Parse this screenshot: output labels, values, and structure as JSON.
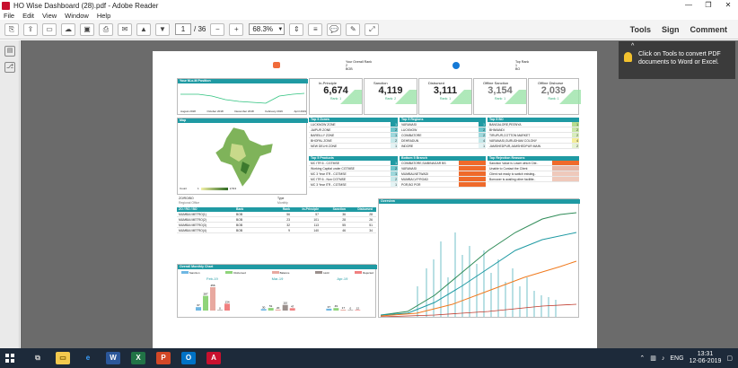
{
  "window": {
    "title": "HO Wise Dashboard (28).pdf - Adobe Reader",
    "minimize": "—",
    "restore": "❐",
    "close": "✕"
  },
  "menu": [
    "File",
    "Edit",
    "View",
    "Window",
    "Help"
  ],
  "toolbar": {
    "page_current": "1",
    "page_total": "/ 36",
    "zoom": "68.3%",
    "tools": "Tools",
    "sign": "Sign",
    "comment": "Comment"
  },
  "tooltip": {
    "text": "Click on Tools to convert PDF documents to Word or Excel."
  },
  "dashboard": {
    "header": {
      "overall_rank_label": "Your Overall Rank",
      "overall_rank_value": "2",
      "overall_rank_sub": "BOB",
      "top_rank_label": "Top Rank",
      "top_rank_value": "1",
      "top_rank_sub": "BO"
    },
    "mom_title": "Your M-o-M Position",
    "mom_axis": [
      "August 2018",
      "October 2018",
      "December 2018",
      "February 2019",
      "April 2019"
    ],
    "kpis": [
      {
        "label": "In-Principle",
        "value": "6,674",
        "rank": "Rank: 1"
      },
      {
        "label": "Sanction",
        "value": "4,119",
        "rank": "Rank: 2"
      },
      {
        "label": "Disbursed",
        "value": "3,111",
        "rank": "Rank: 1"
      },
      {
        "label": "Offline Sanction",
        "value": "3,154",
        "rank": "Rank: 1"
      },
      {
        "label": "Offline Disburse",
        "value": "2,039",
        "rank": "Rank: 1"
      }
    ],
    "map_title": "Map",
    "map_legend": [
      "Count",
      "1",
      "2,513"
    ],
    "top5zone": {
      "title": "Top 5 Zones",
      "rows": [
        [
          "LUCKNOW ZONE",
          "1"
        ],
        [
          "JAIPUR ZONE",
          "2"
        ],
        [
          "BAREILLY ZONE",
          "1"
        ],
        [
          "BHOPAL ZONE",
          "2"
        ],
        [
          "NEW DELHI ZONE",
          "1"
        ]
      ]
    },
    "top5region": {
      "title": "Top 5 Regions",
      "rows": [
        [
          "VARANASI",
          "1"
        ],
        [
          "LUCKNOW",
          "2"
        ],
        [
          "COIMBATORE",
          "2"
        ],
        [
          "DEHRADUN",
          "4"
        ],
        [
          "INDORE",
          "1"
        ]
      ]
    },
    "top5bo": {
      "title": "Top 5 BO",
      "rows": [
        [
          "BANGALORE,PEENYA",
          "1"
        ],
        [
          "BHIWANDI",
          "2"
        ],
        [
          "TIRUPUR,COTTON MARKET",
          "2"
        ],
        [
          "VARANASI,GURUDHAM COLONY",
          "4"
        ],
        [
          "JAMSHEDPUR,JAMSHEDPUR MAIN",
          "2"
        ]
      ]
    },
    "top5products": {
      "title": "Top 5 Products",
      "rows": [
        [
          "MC ITR 6 - CGTMSE",
          "1"
        ],
        [
          "Working Capital under CGTMSE",
          "2"
        ],
        [
          "MC 3 Year ITR - CGTMSE",
          "1"
        ],
        [
          "MC ITR 6 - Non CGTMSE",
          "2"
        ],
        [
          "MC 3 Year ITR - CGTMSE",
          "1"
        ]
      ]
    },
    "bottom5branch": {
      "title": "Bottom 5 Branch",
      "rows": [
        [
          "COIMBATORE,SAIBINAGAR BS",
          "1"
        ],
        [
          "VARANASI",
          "1"
        ],
        [
          "MUMBALNETWADI",
          "1"
        ],
        [
          "MUMBAI,V.P.ROAD",
          "1"
        ],
        [
          "POR,BO POR",
          "1"
        ]
      ]
    },
    "rejections": {
      "title": "Top Rejection Reasons",
      "rows": [
        [
          "Sanction Value is Lower which Clie..",
          "6"
        ],
        [
          "Unable to Contact the Client",
          "5"
        ],
        [
          "Client not ready to switch existing..",
          "2"
        ],
        [
          "Borrower is availing other facilitie..",
          "2"
        ]
      ]
    },
    "filters": {
      "left_label": "ZO/RO/BO",
      "left_value": "Regional Office",
      "right_label": "Type",
      "right_value": "Monthly"
    },
    "overview_title": "Overview",
    "zrb": {
      "headers": [
        "ZO / RO / BO",
        "Bank",
        "Rank",
        "In-Principle",
        "Sanction",
        "Disbursed"
      ],
      "rows": [
        [
          "MUMBAI METRO(1)",
          "BOB",
          "56",
          "57",
          "36",
          "28"
        ],
        [
          "MUMBAI METRO(2)",
          "BOB",
          "23",
          "101",
          "28",
          "26"
        ],
        [
          "MUMBAI METRO(3)",
          "BOB",
          "32",
          "113",
          "55",
          "51"
        ],
        [
          "MUMBAI METRO(4)",
          "BOB",
          "9",
          "140",
          "46",
          "34"
        ]
      ]
    },
    "monthly": {
      "title": "Overall Monthly Chart",
      "legend": [
        "Sanction",
        "Disbursed",
        "Balance",
        "Hold",
        "Rejected"
      ],
      "months": [
        "Feb-19",
        "Mar-19",
        "Apr-19"
      ]
    }
  },
  "chart_data": {
    "type": "bar",
    "title": "Overall Monthly Chart",
    "categories": [
      "Feb-19",
      "Mar-19",
      "Apr-19"
    ],
    "series": [
      {
        "name": "Sanction",
        "values": [
          67,
          30,
          37
        ]
      },
      {
        "name": "Disbursed",
        "values": [
          287,
          51,
          49
        ]
      },
      {
        "name": "Balance",
        "values": [
          456,
          20,
          17
        ]
      },
      {
        "name": "Hold",
        "values": [
          0,
          110,
          0
        ]
      },
      {
        "name": "Rejected",
        "values": [
          134,
          47,
          12
        ]
      }
    ],
    "colors": [
      "#6fb7e3",
      "#8fd47a",
      "#e8a9a0",
      "#9a8f8c",
      "#f08080"
    ]
  },
  "taskbar": {
    "time": "13:31",
    "date": "12-06-2019",
    "lang": "ENG"
  },
  "colors": {
    "teal": "#1f9aa3",
    "taskbar": "#1d2a3a",
    "tip": "#3b3b3b"
  }
}
